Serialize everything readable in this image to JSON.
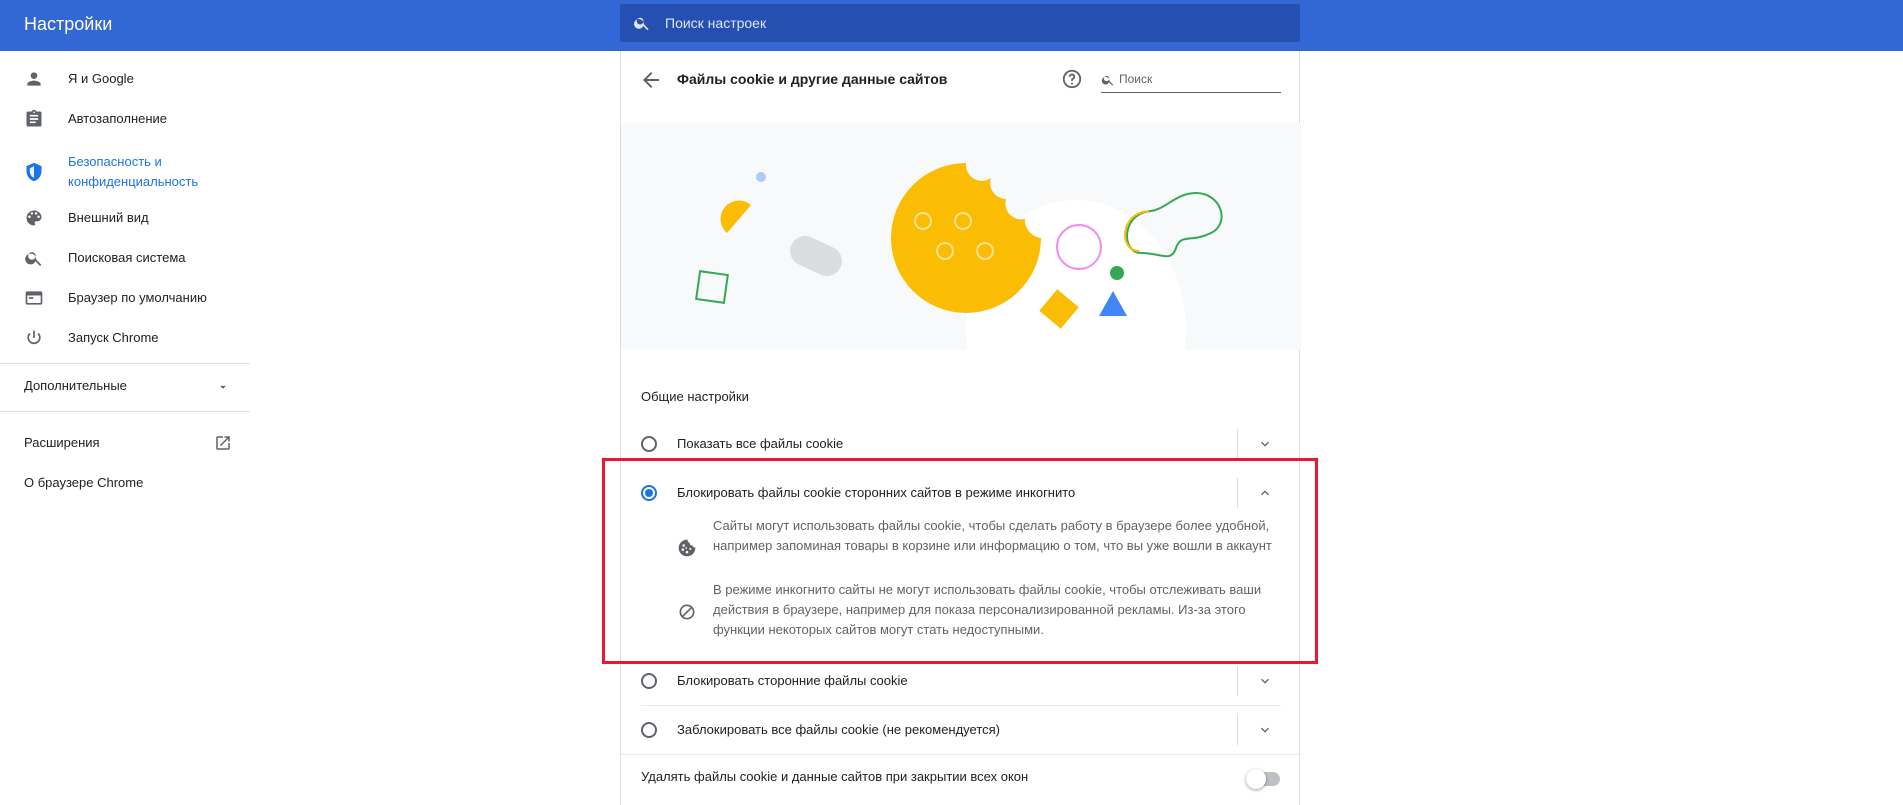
{
  "header": {
    "title": "Настройки",
    "search_placeholder": "Поиск настроек"
  },
  "sidebar": {
    "items": [
      {
        "label": "Я и Google",
        "icon": "person-icon"
      },
      {
        "label": "Автозаполнение",
        "icon": "clipboard-icon"
      },
      {
        "label_line1": "Безопасность и",
        "label_line2": "конфиденциальность",
        "icon": "shield-icon",
        "active": true
      },
      {
        "label": "Внешний вид",
        "icon": "palette-icon"
      },
      {
        "label": "Поисковая система",
        "icon": "search-icon"
      },
      {
        "label": "Браузер по умолчанию",
        "icon": "browser-window-icon"
      },
      {
        "label": "Запуск Chrome",
        "icon": "power-icon"
      }
    ],
    "advanced_label": "Дополнительные",
    "extensions_label": "Расширения",
    "about_label": "О браузере Chrome"
  },
  "page": {
    "title": "Файлы cookie и другие данные сайтов",
    "search_placeholder": "Поиск",
    "section_label": "Общие настройки",
    "options": [
      {
        "label": "Показать все файлы cookie",
        "selected": false,
        "expanded": false
      },
      {
        "label": "Блокировать файлы cookie сторонних сайтов в режиме инкогнито",
        "selected": true,
        "expanded": true
      },
      {
        "label": "Блокировать сторонние файлы cookie",
        "selected": false,
        "expanded": false
      },
      {
        "label": "Заблокировать все файлы cookie (не рекомендуется)",
        "selected": false,
        "expanded": false
      }
    ],
    "details": [
      {
        "icon": "cookie-icon",
        "text": "Сайты могут использовать файлы cookie, чтобы сделать работу в браузере более удобной, например запоминая товары в корзине или информацию о том, что вы уже вошли в аккаунт"
      },
      {
        "icon": "block-icon",
        "text": "В режиме инкогнито сайты не могут использовать файлы cookie, чтобы отслеживать ваши действия в браузере, например для показа персонализированной рекламы. Из-за этого функции некоторых сайтов могут стать недоступными."
      }
    ],
    "toggle_label": "Удалять файлы cookie и данные сайтов при закрытии всех окон",
    "toggle_on": false
  },
  "colors": {
    "header": "#3367d6",
    "accent": "#1a73e8",
    "highlight": "#e8192c",
    "cookie": "#fbbc04"
  }
}
